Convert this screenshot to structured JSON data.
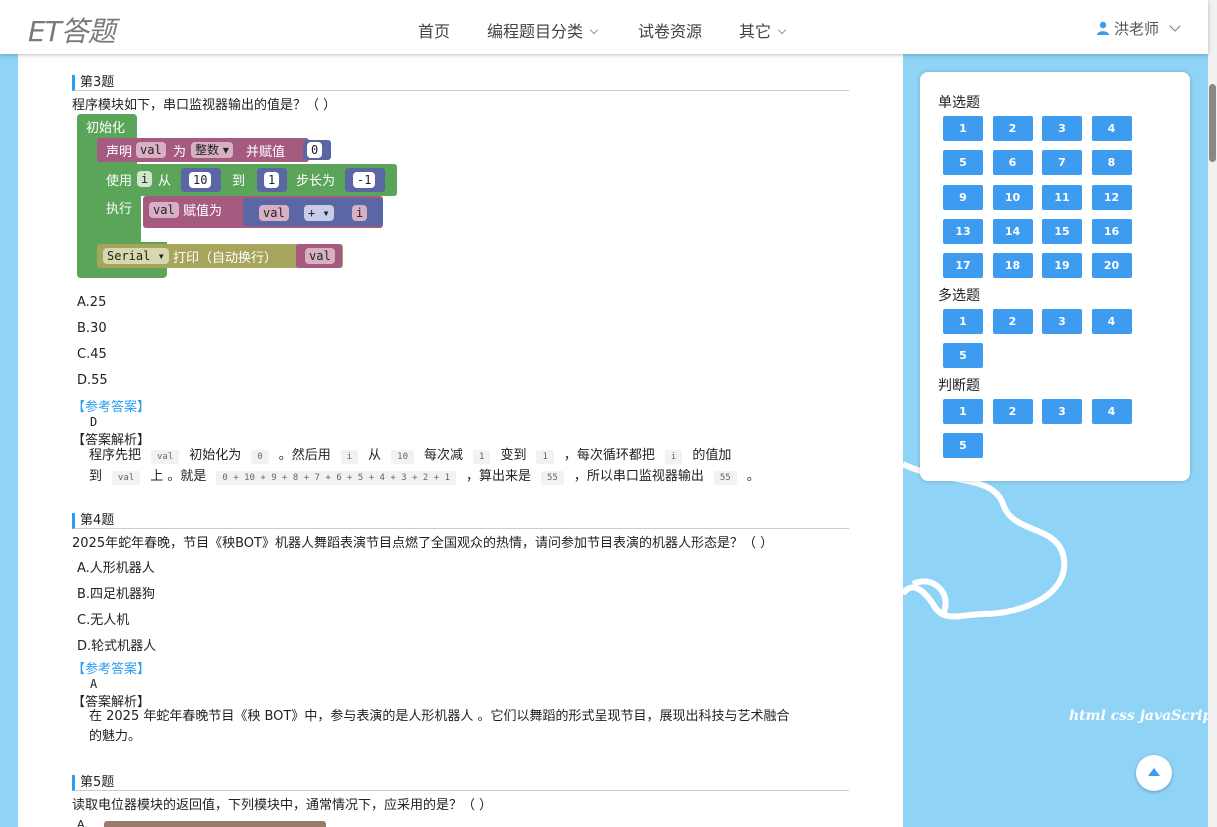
{
  "nav": {
    "logo": "ET答题",
    "items": [
      "首页",
      "编程题目分类",
      "试卷资源",
      "其它"
    ],
    "user": "洪老师"
  },
  "q3": {
    "title": "第3题",
    "stem": "程序模块如下，串口监视器输出的值是？（ ）",
    "blocks": {
      "init": "初始化",
      "declare": "声明",
      "val": "val",
      "as": "为",
      "type": "整数",
      "assign": "并赋值",
      "zero": "0",
      "use": "使用",
      "i": "i",
      "from": "从",
      "ten": "10",
      "to": "到",
      "one": "1",
      "step": "步长为",
      "neg1": "-1",
      "exec": "执行",
      "setto": "赋值为",
      "plus": "+",
      "serial": "Serial",
      "print": "打印（自动换行）"
    },
    "options": [
      "A.25",
      "B.30",
      "C.45",
      "D.55"
    ],
    "answer_label": "【参考答案】",
    "answer": "D",
    "exp_label": "【答案解析】",
    "exp": {
      "t1": "程序先把",
      "c1": "val",
      "t2": "初始化为",
      "c2": "0",
      "t3": "。然后用",
      "c3": "i",
      "t4": "从",
      "c4": "10",
      "t5": "每次减",
      "c5": "1",
      "t6": "变到",
      "c6": "1",
      "t7": "，每次循环都把",
      "c7": "i",
      "t8": "的值加",
      "t9": "到",
      "c8": "val",
      "t10": "上 。就是",
      "c9": "0 + 10 + 9 + 8 + 7 + 6 + 5 + 4 + 3 + 2 + 1",
      "t11": "，算出来是",
      "c10": "55",
      "t12": "，所以串口监视器输出",
      "c11": "55",
      "t13": "。"
    }
  },
  "q4": {
    "title": "第4题",
    "stem": "2025年蛇年春晚，节目《秧BOT》机器人舞蹈表演节目点燃了全国观众的热情，请问参加节目表演的机器人形态是？（ ）",
    "options": [
      "A.人形机器人",
      "B.四足机器狗",
      "C.无人机",
      "D.轮式机器人"
    ],
    "answer_label": "【参考答案】",
    "answer": "A",
    "exp_label": "【答案解析】",
    "exp_line1": "在 2025 年蛇年春晚节目《秧 BOT》中，参与表演的是人形机器人 。它们以舞蹈的形式呈现节目，展现出科技与艺术融合",
    "exp_line2": "的魅力。"
  },
  "q5": {
    "title": "第5题",
    "stem": "读取电位器模块的返回值，下列模块中，通常情况下，应采用的是？（ ）",
    "option_a": "A."
  },
  "panel": {
    "single_title": "单选题",
    "single": [
      "1",
      "2",
      "3",
      "4",
      "5",
      "6",
      "7",
      "8",
      "9",
      "10",
      "11",
      "12",
      "13",
      "14",
      "15",
      "16",
      "17",
      "18",
      "19",
      "20"
    ],
    "multi_title": "多选题",
    "multi": [
      "1",
      "2",
      "3",
      "4",
      "5"
    ],
    "judge_title": "判断题",
    "judge": [
      "1",
      "2",
      "3",
      "4",
      "5"
    ]
  },
  "background_text": "html css javaScript",
  "colors": {
    "accent": "#3d9bf0",
    "bg": "#8fd3f7"
  }
}
